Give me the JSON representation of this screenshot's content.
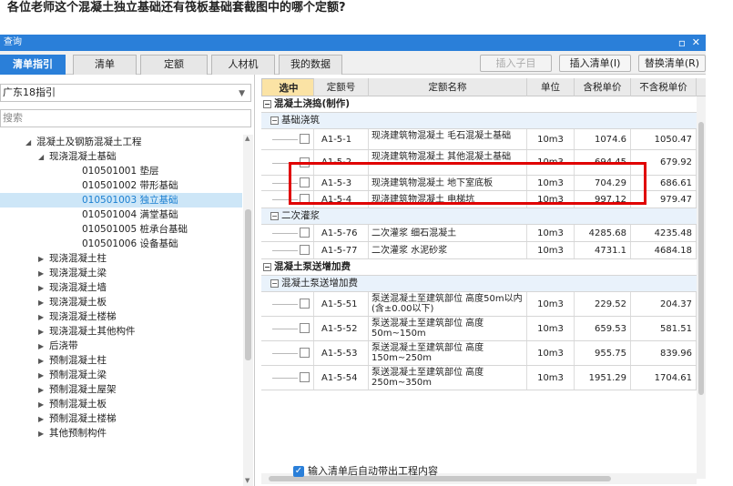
{
  "question": "各位老师这个混凝土独立基础还有筏板基础套截图中的哪个定额?",
  "window": {
    "title": "查询"
  },
  "tabs": [
    "清单指引",
    "清单",
    "定额",
    "人材机",
    "我的数据"
  ],
  "toolbar": {
    "insert_sub": "插入子目",
    "insert_list": "插入清单(I)",
    "replace_list": "替换清单(R)"
  },
  "left": {
    "guide_select": "广东18指引",
    "search_placeholder": "搜索",
    "tree": [
      {
        "label": "混凝土及钢筋混凝土工程",
        "level": 1,
        "toggle": "◢"
      },
      {
        "label": "现浇混凝土基础",
        "level": 2,
        "toggle": "◢"
      },
      {
        "label": "010501001  垫层",
        "level": 3
      },
      {
        "label": "010501002  带形基础",
        "level": 3
      },
      {
        "label": "010501003  独立基础",
        "level": 3,
        "highlight": true
      },
      {
        "label": "010501004  满堂基础",
        "level": 3
      },
      {
        "label": "010501005  桩承台基础",
        "level": 3
      },
      {
        "label": "010501006  设备基础",
        "level": 3
      },
      {
        "label": "现浇混凝土柱",
        "level": 2,
        "toggle": "▶"
      },
      {
        "label": "现浇混凝土梁",
        "level": 2,
        "toggle": "▶"
      },
      {
        "label": "现浇混凝土墙",
        "level": 2,
        "toggle": "▶"
      },
      {
        "label": "现浇混凝土板",
        "level": 2,
        "toggle": "▶"
      },
      {
        "label": "现浇混凝土楼梯",
        "level": 2,
        "toggle": "▶"
      },
      {
        "label": "现浇混凝土其他构件",
        "level": 2,
        "toggle": "▶"
      },
      {
        "label": "后浇带",
        "level": 2,
        "toggle": "▶"
      },
      {
        "label": "预制混凝土柱",
        "level": 2,
        "toggle": "▶"
      },
      {
        "label": "预制混凝土梁",
        "level": 2,
        "toggle": "▶"
      },
      {
        "label": "预制混凝土屋架",
        "level": 2,
        "toggle": "▶"
      },
      {
        "label": "预制混凝土板",
        "level": 2,
        "toggle": "▶"
      },
      {
        "label": "预制混凝土楼梯",
        "level": 2,
        "toggle": "▶"
      },
      {
        "label": "其他预制构件",
        "level": 2,
        "toggle": "▶"
      }
    ]
  },
  "table": {
    "headers": [
      "选中",
      "定额号",
      "定额名称",
      "单位",
      "含税单价",
      "不含税单价"
    ],
    "rows": [
      {
        "kind": "group",
        "toggle": "−",
        "label": "混凝土浇捣(制作)"
      },
      {
        "kind": "subgroup",
        "toggle": "−",
        "label": "基础浇筑"
      },
      {
        "kind": "item",
        "code": "A1-5-1",
        "name": "现浇建筑物混凝土 毛石混凝土基础",
        "unit": "10m3",
        "price_tax": "1074.6",
        "price": "1050.47",
        "h": 23
      },
      {
        "kind": "item",
        "code": "A1-5-2",
        "name": "现浇建筑物混凝土 其他混凝土基础",
        "unit": "10m3",
        "price_tax": "694.45",
        "price": "679.92",
        "h": 28
      },
      {
        "kind": "item",
        "code": "A1-5-3",
        "name": "现浇建筑物混凝土 地下室底板",
        "unit": "10m3",
        "price_tax": "704.29",
        "price": "686.61",
        "h": 17
      },
      {
        "kind": "item",
        "code": "A1-5-4",
        "name": "现浇建筑物混凝土 电梯坑",
        "unit": "10m3",
        "price_tax": "997.12",
        "price": "979.47",
        "h": 19
      },
      {
        "kind": "subgroup",
        "toggle": "−",
        "label": "二次灌浆"
      },
      {
        "kind": "item",
        "code": "A1-5-76",
        "name": "二次灌浆 细石混凝土",
        "unit": "10m3",
        "price_tax": "4285.68",
        "price": "4235.48",
        "h": 19
      },
      {
        "kind": "item",
        "code": "A1-5-77",
        "name": "二次灌浆 水泥砂浆",
        "unit": "10m3",
        "price_tax": "4731.1",
        "price": "4684.18",
        "h": 19
      },
      {
        "kind": "group",
        "toggle": "−",
        "label": "混凝土泵送增加费"
      },
      {
        "kind": "subgroup",
        "toggle": "−",
        "label": "混凝土泵送增加费"
      },
      {
        "kind": "item",
        "code": "A1-5-51",
        "name": "泵送混凝土至建筑部位 高度50m以内(含±0.00以下)",
        "unit": "10m3",
        "price_tax": "229.52",
        "price": "204.37",
        "h": 27
      },
      {
        "kind": "item",
        "code": "A1-5-52",
        "name": "泵送混凝土至建筑部位 高度50m~150m",
        "unit": "10m3",
        "price_tax": "659.53",
        "price": "581.51",
        "h": 27
      },
      {
        "kind": "item",
        "code": "A1-5-53",
        "name": "泵送混凝土至建筑部位 高度150m~250m",
        "unit": "10m3",
        "price_tax": "955.75",
        "price": "839.96",
        "h": 27
      },
      {
        "kind": "item",
        "code": "A1-5-54",
        "name": "泵送混凝土至建筑部位 高度250m~350m",
        "unit": "10m3",
        "price_tax": "1951.29",
        "price": "1704.61",
        "h": 27
      }
    ]
  },
  "footer": {
    "auto_bring": "输入清单后自动带出工程内容"
  },
  "colors": {
    "accent": "#2a7fd9",
    "highlight_box": "#e00000",
    "selected_header": "#fbe3a5"
  },
  "icons": {
    "checkbox_checked": "check-icon",
    "tree_expanded": "triangle-down-icon",
    "tree_collapsed": "triangle-right-icon"
  }
}
